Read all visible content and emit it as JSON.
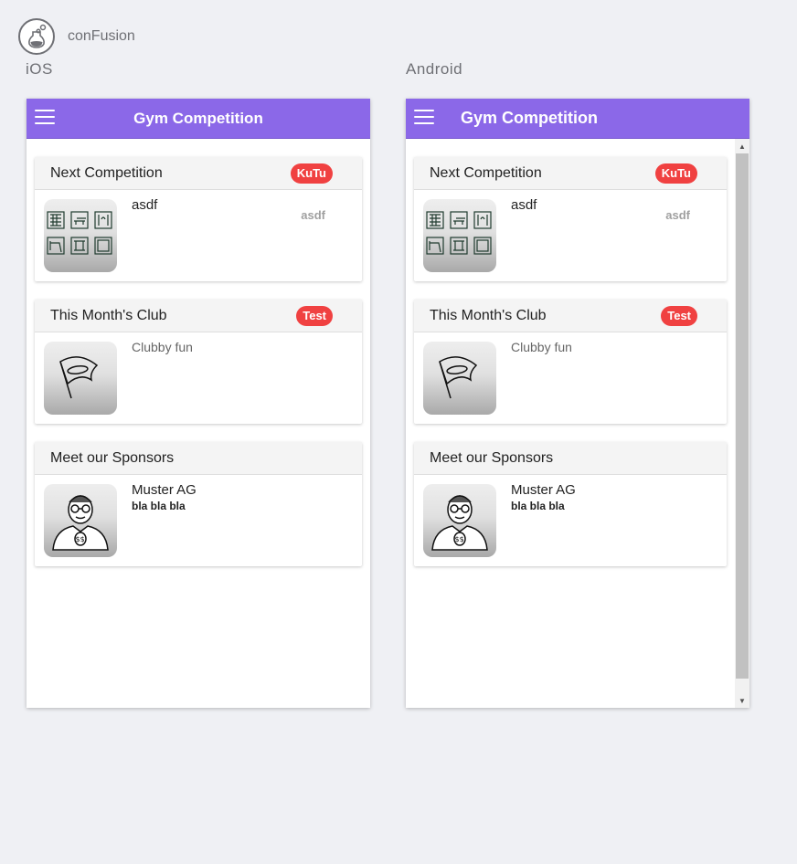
{
  "app": {
    "title": "conFusion"
  },
  "platforms": {
    "ios": {
      "label": "iOS"
    },
    "android": {
      "label": "Android"
    }
  },
  "toolbar": {
    "title": "Gym Competition"
  },
  "cards": [
    {
      "header": "Next Competition",
      "badge": "KuTu",
      "title": "asdf",
      "note": "asdf",
      "image": "gym-apparatus-icon"
    },
    {
      "header": "This Month's Club",
      "badge": "Test",
      "subtitle": "Clubby fun",
      "image": "flag-icon"
    },
    {
      "header": "Meet our Sponsors",
      "title": "Muster AG",
      "detail": "bla bla bla",
      "image": "sponsor-person-icon"
    }
  ],
  "colors": {
    "toolbar": "#8b68e8",
    "badge": "#f04141",
    "background": "#eff0f4"
  },
  "icons": {
    "logo": "flask-logo-icon",
    "menu": "menu-icon"
  }
}
